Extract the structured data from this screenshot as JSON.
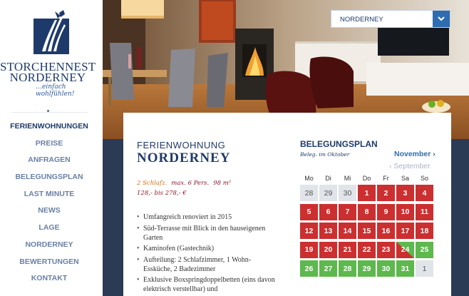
{
  "brand": {
    "line1": "STORCHENNEST",
    "line2": "NORDERNEY",
    "tagline": "…einfach wohlfühlen!"
  },
  "nav": [
    {
      "label": "FERIENWOHNUNGEN",
      "active": true
    },
    {
      "label": "PREISE"
    },
    {
      "label": "ANFRAGEN"
    },
    {
      "label": "BELEGUNGSPLAN"
    },
    {
      "label": "LAST MINUTE"
    },
    {
      "label": "NEWS"
    },
    {
      "label": "LAGE"
    },
    {
      "label": "NORDERNEY"
    },
    {
      "label": "BEWERTUNGEN"
    },
    {
      "label": "KONTAKT"
    }
  ],
  "select": {
    "value": "NORDERNEY"
  },
  "apartment": {
    "label": "FERIENWOHNUNG",
    "name": "NORDERNEY",
    "rooms": "2 Schlafz.",
    "persons": "max. 6 Pers.",
    "size": "98 m²",
    "price": "128,- bis 278,- €",
    "features": [
      "Umfangreich renoviert in 2015",
      "Süd-Terrasse mit Blick in den hauseigenen Garten",
      "Kaminofen (Gastechnik)",
      "Aufteilung: 2 Schlafzimmer, 1 Wohn-Essküche, 2 Badezimmer",
      "Exklusive Boxspringdoppelbetten (eins davon elektrisch verstellbar) und"
    ]
  },
  "calendar": {
    "title": "BELEGUNGSPLAN",
    "subtitle": "Beleg. im Oktober",
    "next": "November",
    "prev": "September",
    "weekdays": [
      "Mo",
      "Di",
      "Mi",
      "Do",
      "Fr",
      "Sa",
      "So"
    ],
    "days": [
      {
        "label": "28",
        "status": "grey"
      },
      {
        "label": "29",
        "status": "grey"
      },
      {
        "label": "30",
        "status": "grey"
      },
      {
        "label": "1",
        "status": "red"
      },
      {
        "label": "2",
        "status": "red"
      },
      {
        "label": "3",
        "status": "red"
      },
      {
        "label": "4",
        "status": "red"
      },
      {
        "label": "5",
        "status": "red"
      },
      {
        "label": "6",
        "status": "red"
      },
      {
        "label": "7",
        "status": "red"
      },
      {
        "label": "8",
        "status": "red"
      },
      {
        "label": "9",
        "status": "red"
      },
      {
        "label": "10",
        "status": "red"
      },
      {
        "label": "11",
        "status": "red"
      },
      {
        "label": "12",
        "status": "red"
      },
      {
        "label": "13",
        "status": "red"
      },
      {
        "label": "14",
        "status": "red"
      },
      {
        "label": "15",
        "status": "red"
      },
      {
        "label": "16",
        "status": "red"
      },
      {
        "label": "17",
        "status": "red"
      },
      {
        "label": "18",
        "status": "red"
      },
      {
        "label": "19",
        "status": "red"
      },
      {
        "label": "20",
        "status": "red"
      },
      {
        "label": "21",
        "status": "red"
      },
      {
        "label": "22",
        "status": "red"
      },
      {
        "label": "23",
        "status": "red"
      },
      {
        "label": "24",
        "status": "split"
      },
      {
        "label": "25",
        "status": "green"
      },
      {
        "label": "26",
        "status": "green"
      },
      {
        "label": "27",
        "status": "green"
      },
      {
        "label": "28",
        "status": "green"
      },
      {
        "label": "29",
        "status": "green"
      },
      {
        "label": "30",
        "status": "green"
      },
      {
        "label": "31",
        "status": "green"
      },
      {
        "label": "1",
        "status": "grey"
      }
    ]
  },
  "colors": {
    "booked": "#cc2f30",
    "free": "#5db84d",
    "other_month": "#e1e4e9",
    "brand": "#1e3a6a"
  }
}
